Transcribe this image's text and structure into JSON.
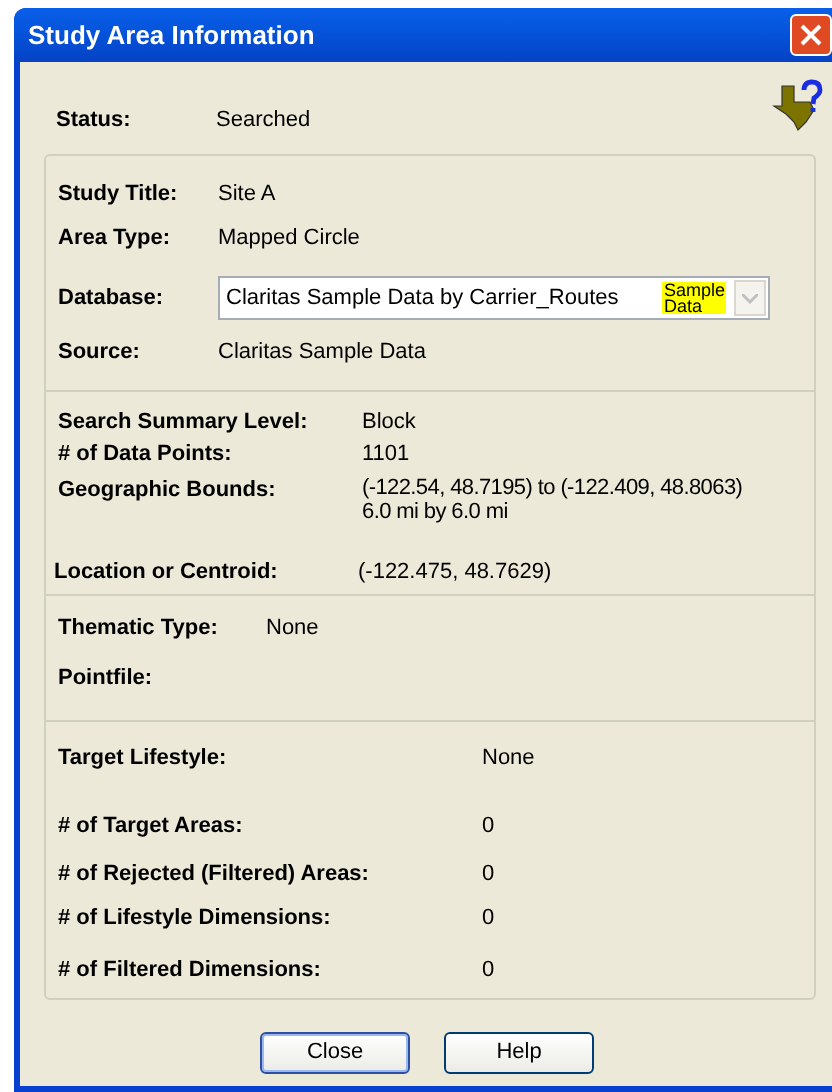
{
  "window": {
    "title": "Study Area Information"
  },
  "status": {
    "label": "Status:",
    "value": "Searched"
  },
  "sections": [
    {
      "rows": [
        {
          "kind": "text",
          "label": "Study Title:",
          "value": "Site A"
        },
        {
          "kind": "text",
          "label": "Area Type:",
          "value": "Mapped Circle"
        },
        {
          "kind": "dropdown",
          "label": "Database:",
          "value": "Claritas Sample Data by Carrier_Routes",
          "badge": "Sample Data"
        },
        {
          "kind": "text",
          "label": "Source:",
          "value": "Claritas Sample Data"
        }
      ]
    },
    {
      "rows": [
        {
          "kind": "text",
          "label": "Search Summary Level:",
          "value": "Block"
        },
        {
          "kind": "text",
          "label": "# of Data Points:",
          "value": "1101"
        },
        {
          "kind": "multiline",
          "label": "Geographic Bounds:",
          "lines": [
            "(-122.54, 48.7195) to (-122.409, 48.8063)",
            "6.0 mi by 6.0 mi"
          ]
        },
        {
          "kind": "text",
          "label": "Location or Centroid:",
          "value": "(-122.475, 48.7629)"
        }
      ]
    },
    {
      "rows": [
        {
          "kind": "text",
          "label": "Thematic Type:",
          "value": "None"
        },
        {
          "kind": "text",
          "label": "Pointfile:"
        }
      ]
    },
    {
      "rows": [
        {
          "kind": "text",
          "label": "Target Lifestyle:",
          "value": "None"
        },
        {
          "kind": "text",
          "label": "# of Target Areas:",
          "value": "0"
        },
        {
          "kind": "text",
          "label": "# of Rejected (Filtered) Areas:",
          "value": "0"
        },
        {
          "kind": "text",
          "label": "# of Lifestyle Dimensions:",
          "value": "0"
        },
        {
          "kind": "text",
          "label": "# of Filtered Dimensions:",
          "value": "0"
        }
      ]
    }
  ],
  "buttons": [
    {
      "label": "Close",
      "default": true
    },
    {
      "label": "Help",
      "default": false
    }
  ]
}
